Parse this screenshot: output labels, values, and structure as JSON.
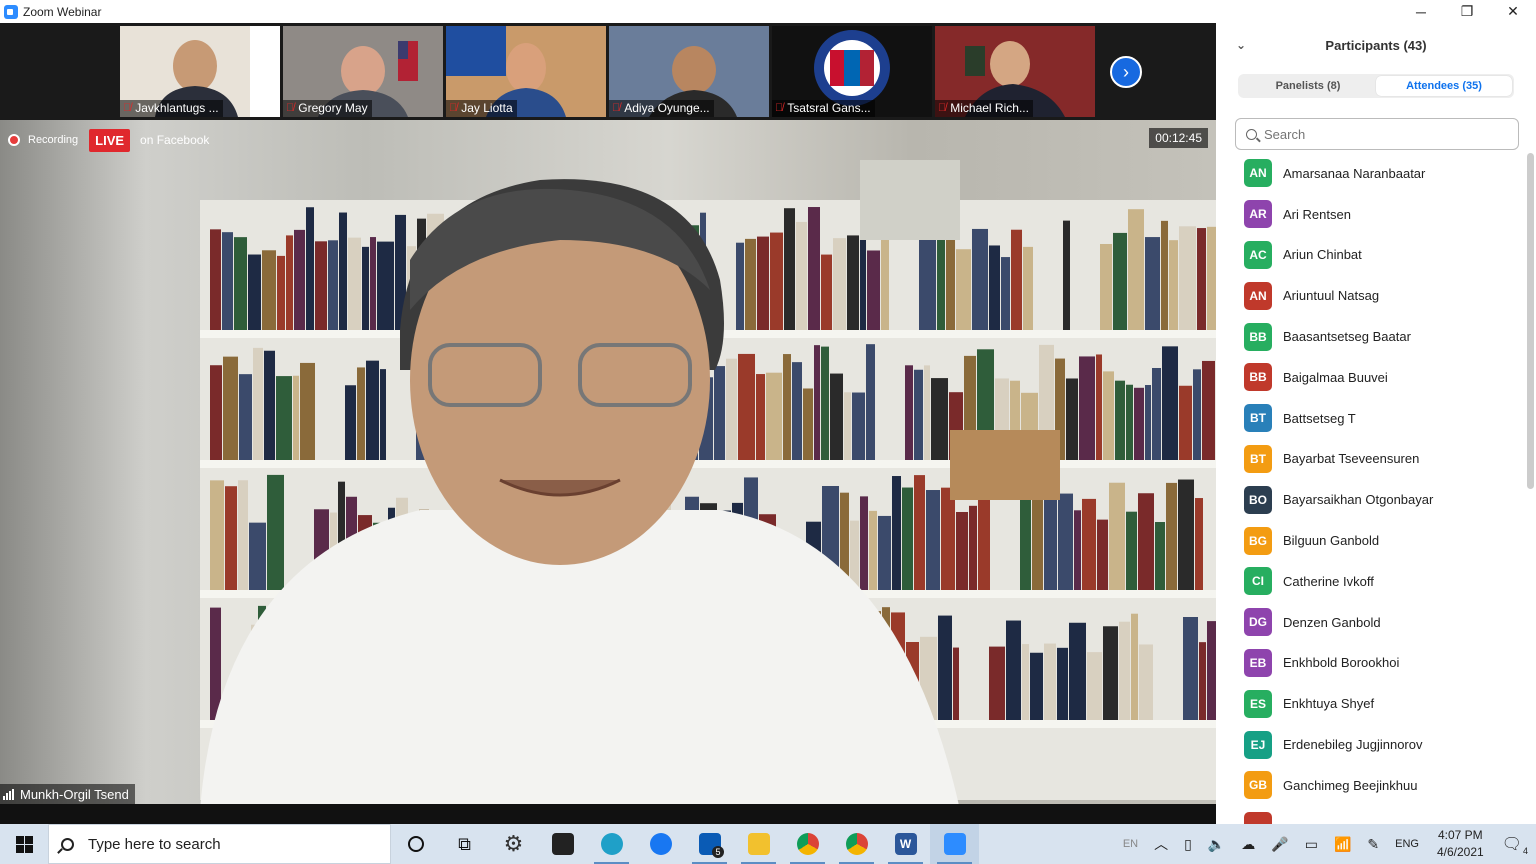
{
  "window": {
    "title": "Zoom Webinar",
    "minimize": "─",
    "restore": "❐",
    "close": "✕"
  },
  "thumbnails": [
    {
      "name": "Javkhlantugs ...",
      "bg": "#e8e2d8"
    },
    {
      "name": "Gregory May",
      "bg": "#8f8a86"
    },
    {
      "name": "Jay Liotta",
      "bg": "#c99a6a"
    },
    {
      "name": "Adiya Oyunge...",
      "bg": "#6a7d9a"
    },
    {
      "name": "Tsatsral Gans...",
      "bg": "#111111"
    },
    {
      "name": "Michael Rich...",
      "bg": "#6b2a2a"
    }
  ],
  "recording": {
    "label": "Recording",
    "live": "LIVE",
    "platform": "on Facebook",
    "timer": "00:12:45"
  },
  "speaker": {
    "name": "Munkh-Orgil Tsend"
  },
  "panel": {
    "title": "Participants (43)",
    "tab_panelists": "Panelists (8)",
    "tab_attendees": "Attendees (35)",
    "search_placeholder": "Search",
    "participants": [
      {
        "initials": "AN",
        "name": "Amarsanaa Naranbaatar",
        "color": "#27ae60"
      },
      {
        "initials": "AR",
        "name": "Ari Rentsen",
        "color": "#8e44ad"
      },
      {
        "initials": "AC",
        "name": "Ariun Chinbat",
        "color": "#27ae60"
      },
      {
        "initials": "AN",
        "name": "Ariuntuul Natsag",
        "color": "#c0392b"
      },
      {
        "initials": "BB",
        "name": "Baasantsetseg Baatar",
        "color": "#27ae60"
      },
      {
        "initials": "BB",
        "name": "Baigalmaa Buuvei",
        "color": "#c0392b"
      },
      {
        "initials": "BT",
        "name": "Battsetseg T",
        "color": "#2980b9"
      },
      {
        "initials": "BT",
        "name": "Bayarbat Tseveensuren",
        "color": "#f39c12"
      },
      {
        "initials": "BO",
        "name": "Bayarsaikhan Otgonbayar",
        "color": "#2c3e50"
      },
      {
        "initials": "BG",
        "name": "Bilguun Ganbold",
        "color": "#f39c12"
      },
      {
        "initials": "CI",
        "name": "Catherine Ivkoff",
        "color": "#27ae60"
      },
      {
        "initials": "DG",
        "name": "Denzen Ganbold",
        "color": "#8e44ad"
      },
      {
        "initials": "EB",
        "name": "Enkhbold Borookhoi",
        "color": "#8e44ad"
      },
      {
        "initials": "ES",
        "name": "Enkhtuya Shyef",
        "color": "#27ae60"
      },
      {
        "initials": "EJ",
        "name": "Erdenebileg Jugjinnorov",
        "color": "#16a085"
      },
      {
        "initials": "GB",
        "name": "Ganchimeg Beejinkhuu",
        "color": "#f39c12"
      },
      {
        "initials": "",
        "name": "",
        "color": "#c0392b"
      }
    ]
  },
  "taskbar": {
    "search_placeholder": "Type here to search",
    "lang_en": "EN",
    "lang": "ENG",
    "time": "4:07 PM",
    "date": "4/6/2021",
    "mail_badge": "5",
    "notif_count": "4"
  }
}
